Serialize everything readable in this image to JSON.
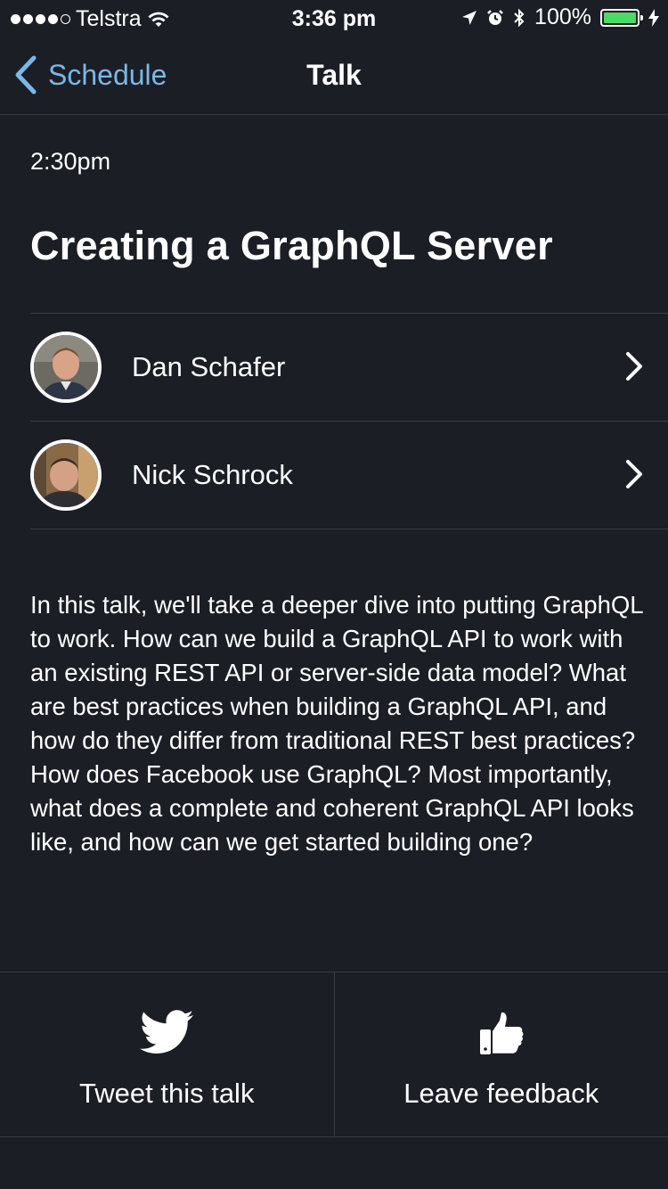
{
  "status_bar": {
    "carrier": "Telstra",
    "time": "3:36 pm",
    "battery": "100%",
    "battery_level": 1.0,
    "icons": [
      "signal-dots-icon",
      "wifi-icon",
      "location-arrow-icon",
      "alarm-icon",
      "bluetooth-icon",
      "battery-icon",
      "charging-bolt-icon"
    ]
  },
  "nav": {
    "back_label": "Schedule",
    "title": "Talk"
  },
  "talk": {
    "time": "2:30pm",
    "title": "Creating a GraphQL Server",
    "speakers": [
      {
        "name": "Dan Schafer"
      },
      {
        "name": "Nick Schrock"
      }
    ],
    "description": "In this talk, we'll take a deeper dive into putting GraphQL to work. How can we build a GraphQL API to work with an existing REST API or server-side data model? What are best practices when building a GraphQL API, and how do they differ from traditional REST best practices? How does Facebook use GraphQL? Most importantly, what does a complete and coherent GraphQL API looks like, and how can we get started building one?"
  },
  "actions": {
    "tweet_label": "Tweet this talk",
    "tweet_icon": "twitter-bird-icon",
    "feedback_label": "Leave feedback",
    "feedback_icon": "thumbs-up-icon"
  },
  "colors": {
    "background": "#1c1e26",
    "accent": "#79b8e6",
    "divider": "#3a3c45",
    "battery_green": "#4cd964"
  }
}
